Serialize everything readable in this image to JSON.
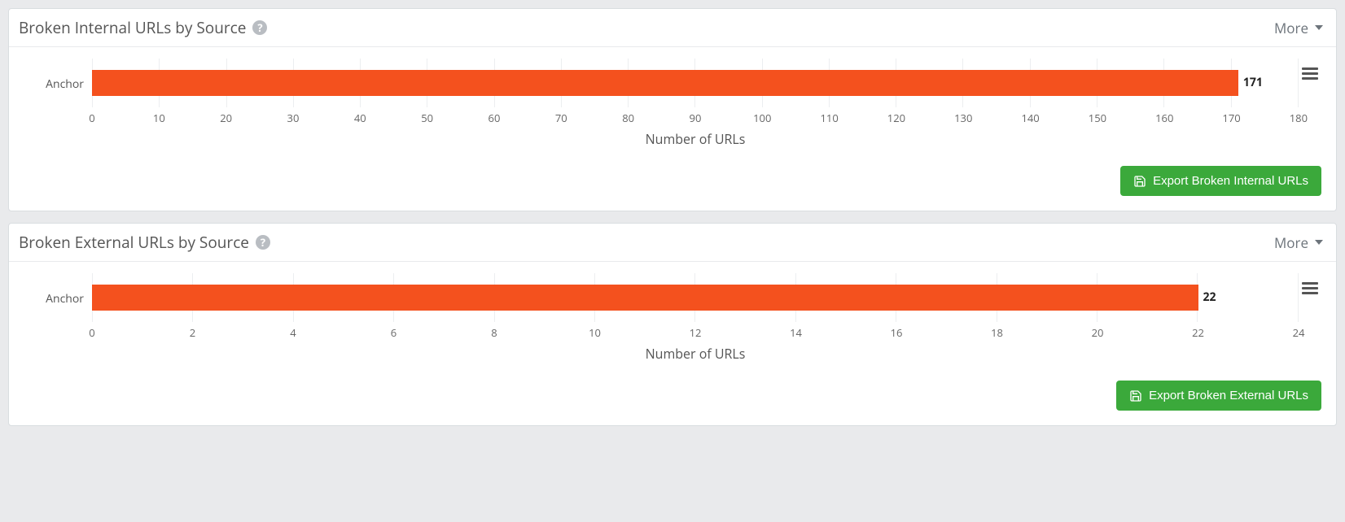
{
  "panels": [
    {
      "title": "Broken Internal URLs by Source",
      "more_label": "More",
      "y_category": "Anchor",
      "value": 171,
      "value_label": "171",
      "x_axis_title": "Number of URLs",
      "ticks": [
        "0",
        "10",
        "20",
        "30",
        "40",
        "50",
        "60",
        "70",
        "80",
        "90",
        "100",
        "110",
        "120",
        "130",
        "140",
        "150",
        "160",
        "170",
        "180"
      ],
      "x_max": 180,
      "export_label": "Export Broken Internal URLs"
    },
    {
      "title": "Broken External URLs by Source",
      "more_label": "More",
      "y_category": "Anchor",
      "value": 22,
      "value_label": "22",
      "x_axis_title": "Number of URLs",
      "ticks": [
        "0",
        "2",
        "4",
        "6",
        "8",
        "10",
        "12",
        "14",
        "16",
        "18",
        "20",
        "22",
        "24"
      ],
      "x_max": 24,
      "export_label": "Export Broken External URLs"
    }
  ],
  "chart_data": [
    {
      "type": "bar",
      "orientation": "horizontal",
      "title": "Broken Internal URLs by Source",
      "categories": [
        "Anchor"
      ],
      "values": [
        171
      ],
      "xlabel": "Number of URLs",
      "ylabel": "",
      "xlim": [
        0,
        180
      ]
    },
    {
      "type": "bar",
      "orientation": "horizontal",
      "title": "Broken External URLs by Source",
      "categories": [
        "Anchor"
      ],
      "values": [
        22
      ],
      "xlabel": "Number of URLs",
      "ylabel": "",
      "xlim": [
        0,
        24
      ]
    }
  ]
}
